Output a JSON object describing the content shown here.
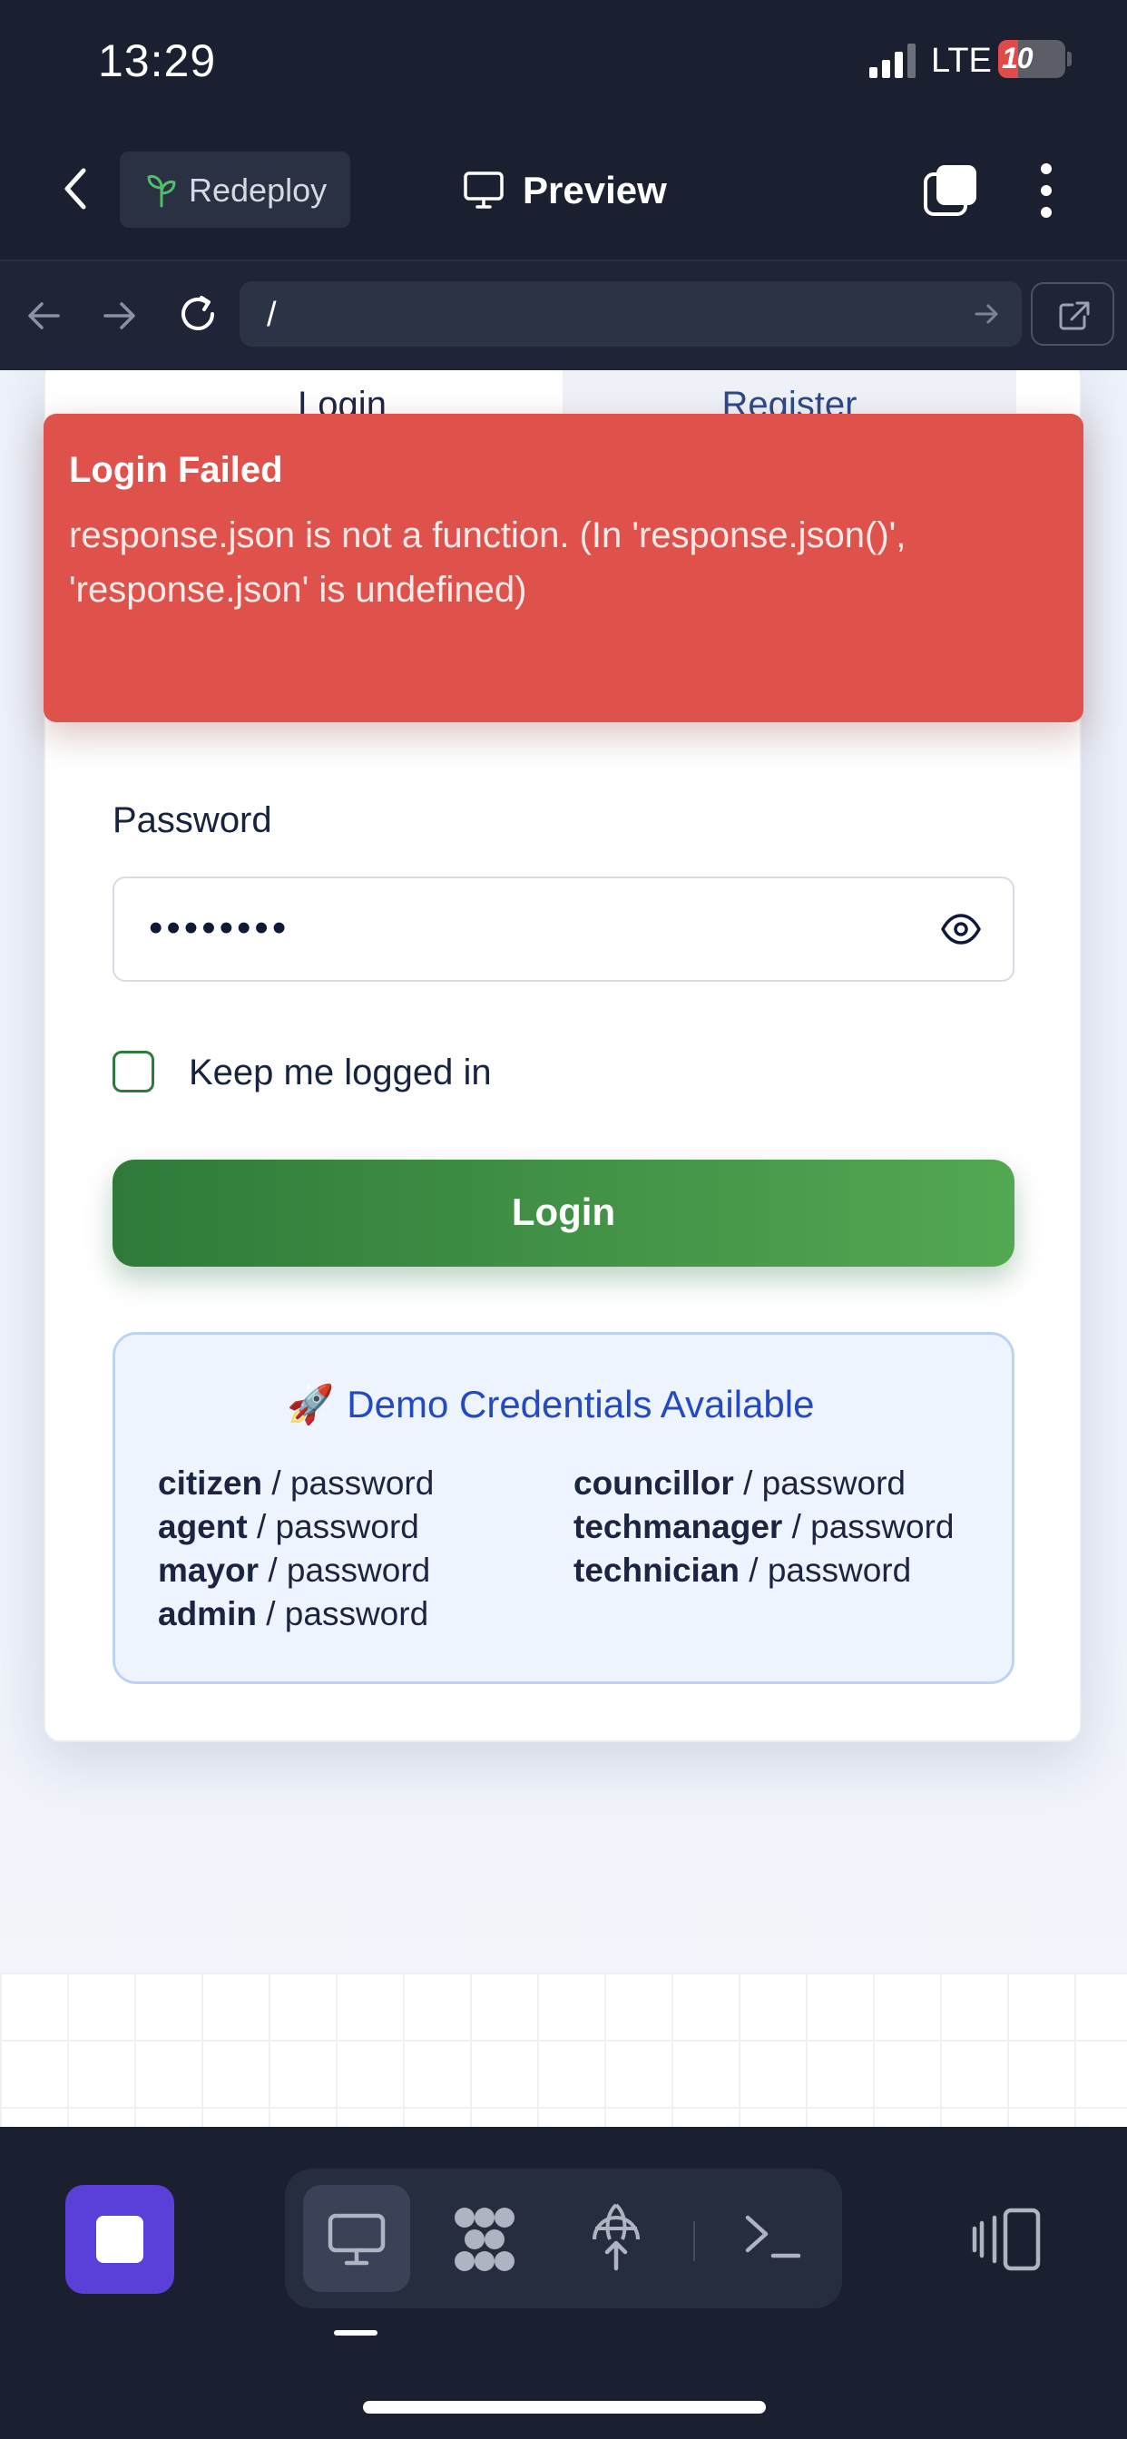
{
  "status_bar": {
    "time": "13:29",
    "network": "LTE",
    "battery": "10"
  },
  "toolbar": {
    "redeploy_label": "Redeploy",
    "preview_label": "Preview"
  },
  "address_bar": {
    "url": "/"
  },
  "auth": {
    "tabs": [
      {
        "label": "Login",
        "active": true
      },
      {
        "label": "Register",
        "active": false
      }
    ],
    "error": {
      "title": "Login Failed",
      "message": "response.json is not a function. (In 'response.json()', 'response.json' is undefined)"
    },
    "password_label": "Password",
    "password_value": "••••••••",
    "keep_logged_in_label": "Keep me logged in",
    "keep_logged_in_checked": false,
    "login_button": "Login",
    "demo": {
      "icon": "🚀",
      "title": "Demo Credentials Available",
      "credentials": [
        {
          "user": "citizen",
          "rest": " / password"
        },
        {
          "user": "councillor",
          "rest": " / password"
        },
        {
          "user": "agent",
          "rest": " / password"
        },
        {
          "user": "techmanager",
          "rest": " / password"
        },
        {
          "user": "mayor",
          "rest": " / password"
        },
        {
          "user": "technician",
          "rest": " / password"
        },
        {
          "user": "admin",
          "rest": " / password"
        }
      ]
    }
  },
  "colors": {
    "chrome_bg": "#1b2030",
    "error_bg": "#de524b",
    "login_gradient_start": "#2f7a3a",
    "login_gradient_end": "#53a852",
    "demo_title": "#2349c4",
    "stop_button": "#5b3fd9"
  },
  "icons": {
    "toolbar": [
      "back-icon",
      "sprout-icon",
      "monitor-icon",
      "tabs-icon",
      "more-vertical-icon"
    ],
    "browser": [
      "arrow-left-icon",
      "arrow-right-icon",
      "reload-icon",
      "go-arrow-icon",
      "external-link-icon"
    ],
    "dock": [
      "stop-icon",
      "monitor-icon",
      "nodes-icon",
      "deploy-globe-icon",
      "terminal-icon",
      "side-panel-icon"
    ]
  }
}
